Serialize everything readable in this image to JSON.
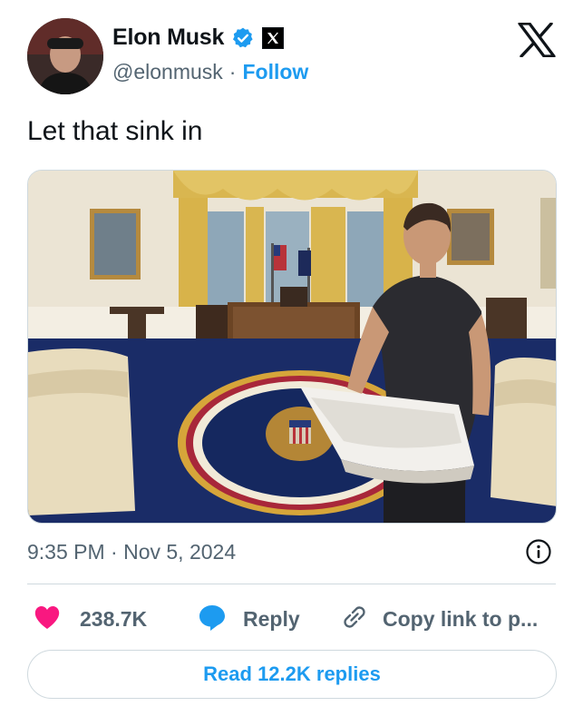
{
  "author": {
    "name": "Elon Musk",
    "handle": "@elonmusk",
    "separator": "·",
    "follow_label": "Follow",
    "verified_color": "#1d9bf0"
  },
  "tweet": {
    "text": "Let that sink in",
    "timestamp": "9:35 PM · Nov 5, 2024"
  },
  "actions": {
    "likes": "238.7K",
    "reply_label": "Reply",
    "copy_label": "Copy link to p..."
  },
  "read_replies_label": "Read 12.2K replies",
  "colors": {
    "accent": "#1d9bf0",
    "like": "#f91880",
    "muted": "#536471"
  },
  "icons": [
    "x-logo-icon",
    "verified-badge-icon",
    "affiliate-x-icon",
    "info-icon",
    "heart-icon",
    "reply-bubble-icon",
    "link-icon"
  ]
}
